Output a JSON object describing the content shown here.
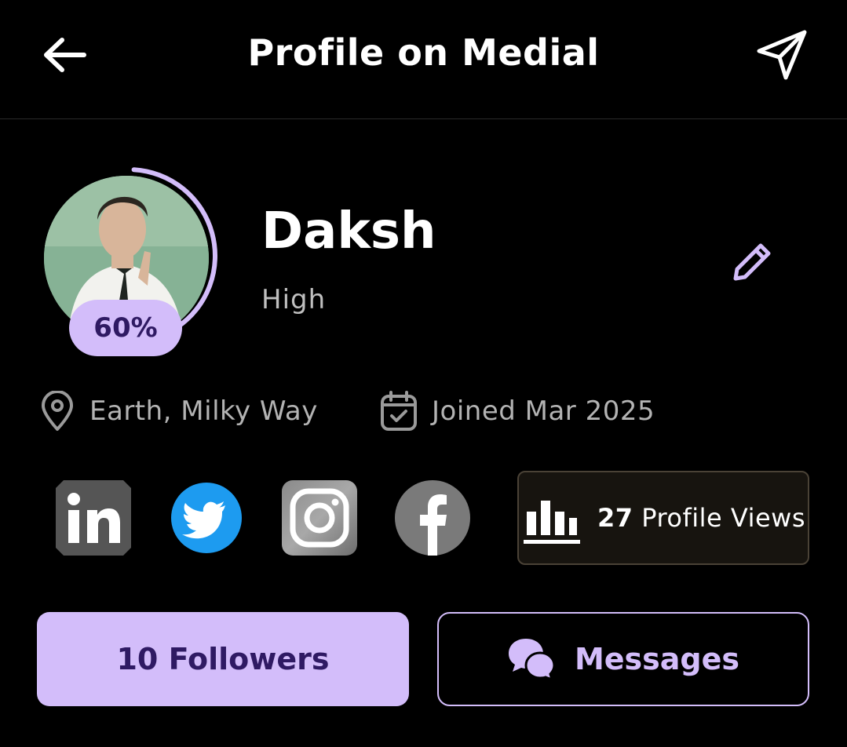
{
  "header": {
    "title": "Profile on Medial",
    "back_icon": "arrow-left-icon",
    "share_icon": "send-icon"
  },
  "profile": {
    "name": "Daksh",
    "level": "High",
    "completion_label": "60%",
    "completion_fraction": 0.6,
    "location": "Earth, Milky Way",
    "joined": "Joined Mar 2025"
  },
  "socials": [
    {
      "name": "linkedin",
      "icon": "linkedin-icon"
    },
    {
      "name": "twitter",
      "icon": "twitter-icon"
    },
    {
      "name": "instagram",
      "icon": "instagram-icon"
    },
    {
      "name": "facebook",
      "icon": "facebook-icon"
    }
  ],
  "views": {
    "count": "27",
    "label": "Profile Views"
  },
  "actions": {
    "followers_label": "10 Followers",
    "messages_label": "Messages"
  },
  "colors": {
    "accent": "#d3bdfa",
    "accent_text": "#2f1a63",
    "background": "#000000",
    "muted_text": "#b3b3b3"
  }
}
